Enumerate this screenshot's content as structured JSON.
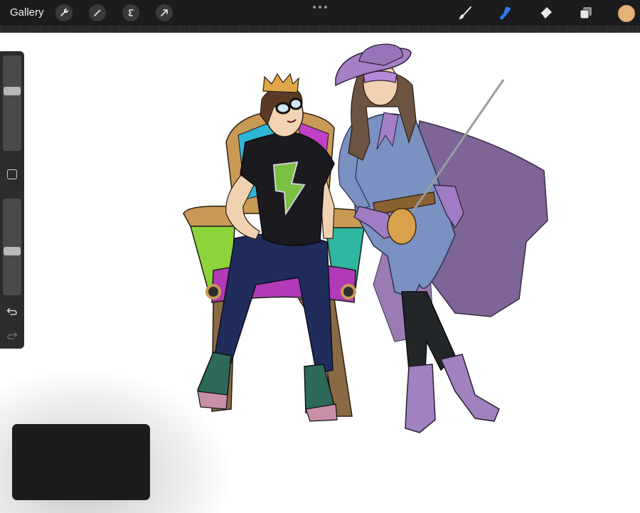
{
  "toolbar": {
    "gallery_label": "Gallery",
    "left_tools": [
      "wrench-icon",
      "magic-wand-icon",
      "selection-icon",
      "transform-arrow-icon"
    ],
    "more_icon": "more-dots-icon",
    "right_tools": [
      "brush-icon",
      "smudge-icon",
      "eraser-icon",
      "layers-icon"
    ],
    "active_tool": "smudge",
    "active_color": "#e6b07a",
    "accent_color": "#2f7bf6"
  },
  "sidebar": {
    "brush_size": 0.36,
    "brush_opacity": 0.55,
    "icons": [
      "modify-square-icon",
      "undo-icon",
      "redo-icon"
    ]
  },
  "canvas": {
    "artwork": "illustration-king-and-musketeer"
  }
}
